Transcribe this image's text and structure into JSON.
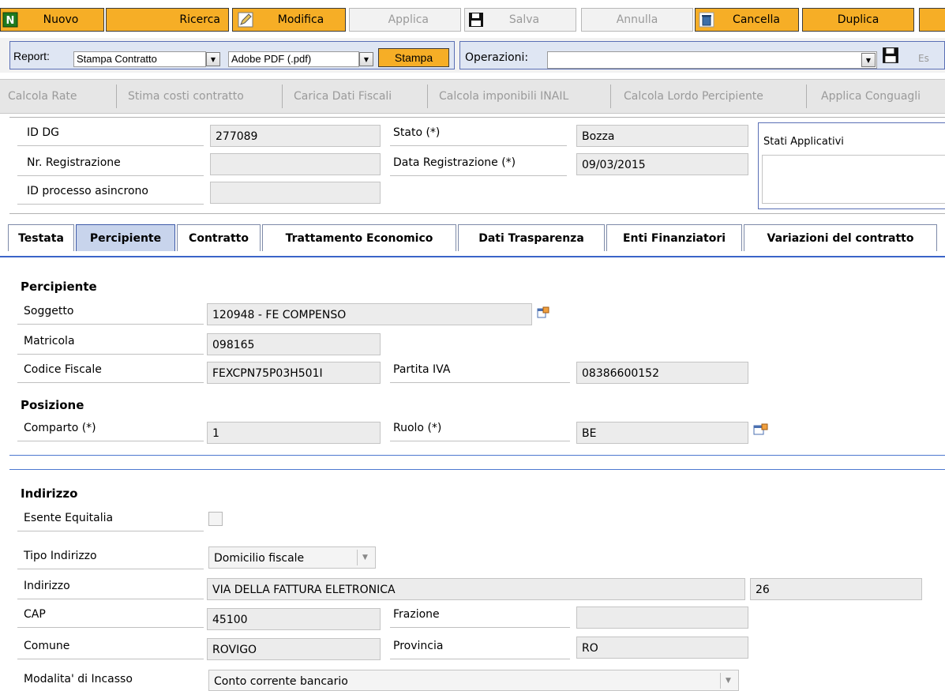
{
  "toolbar": {
    "nuovo": "Nuovo",
    "ricerca": "Ricerca",
    "modifica": "Modifica",
    "applica": "Applica",
    "salva": "Salva",
    "annulla": "Annulla",
    "cancella": "Cancella",
    "duplica": "Duplica"
  },
  "report": {
    "label": "Report:",
    "report_value": "Stampa Contratto",
    "format_value": "Adobe PDF (.pdf)",
    "stampa": "Stampa",
    "operazioni_label": "Operazioni:",
    "esegui": "Es"
  },
  "actions": [
    "Calcola Rate",
    "Stima costi contratto",
    "Carica Dati Fiscali",
    "Calcola imponibili INAIL",
    "Calcola Lordo Percipiente",
    "Applica Conguagli"
  ],
  "header": {
    "id_dg_label": "ID DG",
    "id_dg_value": "277089",
    "stato_label": "Stato (*)",
    "stato_value": "Bozza",
    "nr_reg_label": "Nr. Registrazione",
    "nr_reg_value": "",
    "data_reg_label": "Data Registrazione (*)",
    "data_reg_value": "09/03/2015",
    "id_proc_label": "ID processo asincrono",
    "id_proc_value": "",
    "stati_applicativi": "Stati Applicativi"
  },
  "tabs": [
    "Testata",
    "Percipiente",
    "Contratto",
    "Trattamento Economico",
    "Dati Trasparenza",
    "Enti Finanziatori",
    "Variazioni del contratto"
  ],
  "percipiente": {
    "title": "Percipiente",
    "soggetto_label": "Soggetto",
    "soggetto_value": "120948 - FE COMPENSO",
    "matricola_label": "Matricola",
    "matricola_value": "098165",
    "cf_label": "Codice Fiscale",
    "cf_value": "FEXCPN75P03H501I",
    "piva_label": "Partita IVA",
    "piva_value": "08386600152"
  },
  "posizione": {
    "title": "Posizione",
    "comparto_label": "Comparto (*)",
    "comparto_value": "1",
    "ruolo_label": "Ruolo (*)",
    "ruolo_value": "BE"
  },
  "indirizzo": {
    "title": "Indirizzo",
    "esente_label": "Esente Equitalia",
    "tipo_label": "Tipo Indirizzo",
    "tipo_value": "Domicilio fiscale",
    "indirizzo_label": "Indirizzo",
    "indirizzo_value": "VIA DELLA FATTURA ELETRONICA",
    "civico_value": "26",
    "cap_label": "CAP",
    "cap_value": "45100",
    "frazione_label": "Frazione",
    "frazione_value": "",
    "comune_label": "Comune",
    "comune_value": "ROVIGO",
    "provincia_label": "Provincia",
    "provincia_value": "RO",
    "modalita_label": "Modalita' di Incasso",
    "modalita_value": "Conto corrente bancario"
  }
}
